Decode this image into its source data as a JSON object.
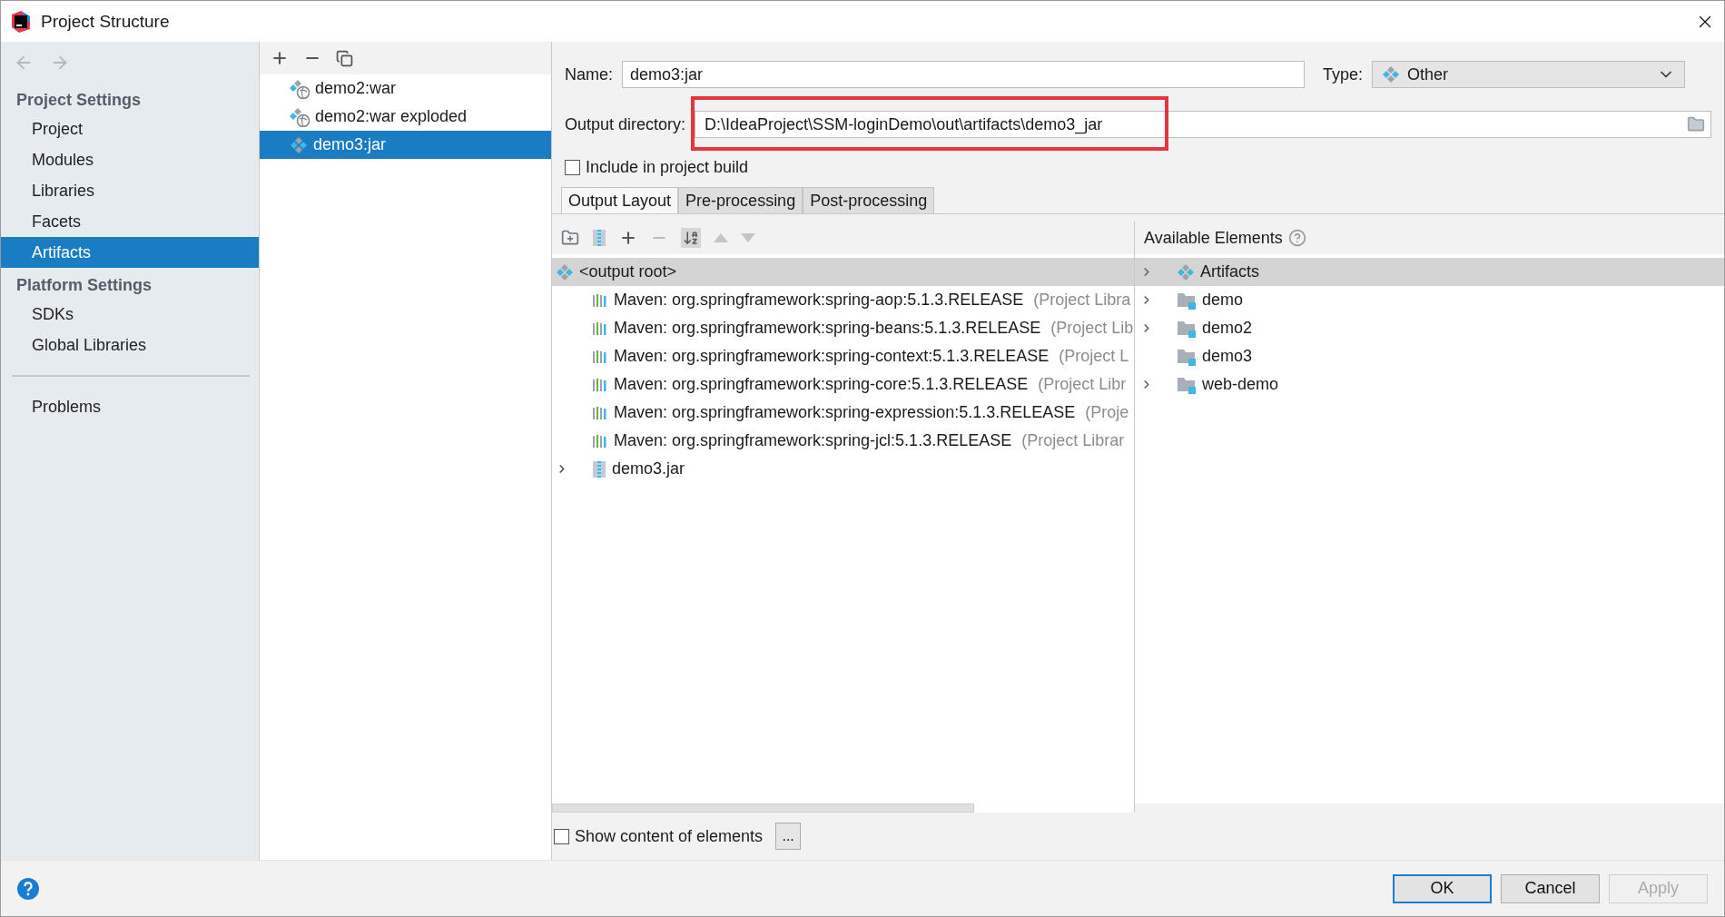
{
  "window": {
    "title": "Project Structure"
  },
  "sidebar": {
    "groups": [
      {
        "heading": "Project Settings",
        "items": [
          {
            "label": "Project",
            "selected": false
          },
          {
            "label": "Modules",
            "selected": false
          },
          {
            "label": "Libraries",
            "selected": false
          },
          {
            "label": "Facets",
            "selected": false
          },
          {
            "label": "Artifacts",
            "selected": true
          }
        ]
      },
      {
        "heading": "Platform Settings",
        "items": [
          {
            "label": "SDKs",
            "selected": false
          },
          {
            "label": "Global Libraries",
            "selected": false
          }
        ]
      }
    ],
    "footer_items": [
      {
        "label": "Problems",
        "selected": false
      }
    ]
  },
  "artifacts_list": [
    {
      "label": "demo2:war",
      "kind": "war",
      "selected": false
    },
    {
      "label": "demo2:war exploded",
      "kind": "war",
      "selected": false
    },
    {
      "label": "demo3:jar",
      "kind": "jar",
      "selected": true
    }
  ],
  "form": {
    "name_label": "Name:",
    "name_value": "demo3:jar",
    "type_label": "Type:",
    "type_value": "Other",
    "output_label": "Output directory:",
    "output_value": "D:\\IdeaProject\\SSM-loginDemo\\out\\artifacts\\demo3_jar",
    "output_highlighted": true,
    "include_label": "Include in project build",
    "include_checked": false
  },
  "tabs": [
    {
      "label": "Output Layout",
      "selected": true
    },
    {
      "label": "Pre-processing",
      "selected": false
    },
    {
      "label": "Post-processing",
      "selected": false
    }
  ],
  "layout_tree": [
    {
      "kind": "root",
      "label": "<output root>",
      "selected": true
    },
    {
      "kind": "library",
      "label": "Maven: org.springframework:spring-aop:5.1.3.RELEASE",
      "suffix": "(Project Libra",
      "selected": false
    },
    {
      "kind": "library",
      "label": "Maven: org.springframework:spring-beans:5.1.3.RELEASE",
      "suffix": "(Project Lib",
      "selected": false
    },
    {
      "kind": "library",
      "label": "Maven: org.springframework:spring-context:5.1.3.RELEASE",
      "suffix": "(Project L",
      "selected": false
    },
    {
      "kind": "library",
      "label": "Maven: org.springframework:spring-core:5.1.3.RELEASE",
      "suffix": "(Project Libr",
      "selected": false
    },
    {
      "kind": "library",
      "label": "Maven: org.springframework:spring-expression:5.1.3.RELEASE",
      "suffix": "(Proje",
      "selected": false
    },
    {
      "kind": "library",
      "label": "Maven: org.springframework:spring-jcl:5.1.3.RELEASE",
      "suffix": "(Project Librar",
      "selected": false
    },
    {
      "kind": "jar",
      "label": "demo3.jar",
      "expandable": true,
      "selected": false
    }
  ],
  "available": {
    "title": "Available Elements",
    "items": [
      {
        "kind": "artifacts",
        "label": "Artifacts",
        "expandable": true,
        "selected": true
      },
      {
        "kind": "module",
        "label": "demo",
        "expandable": true,
        "selected": false
      },
      {
        "kind": "module",
        "label": "demo2",
        "expandable": true,
        "selected": false
      },
      {
        "kind": "module",
        "label": "demo3",
        "expandable": false,
        "selected": false
      },
      {
        "kind": "module",
        "label": "web-demo",
        "expandable": true,
        "selected": false
      }
    ]
  },
  "show_content": {
    "label": "Show content of elements",
    "checked": false
  },
  "more_button": "...",
  "buttons": [
    {
      "label": "OK",
      "kind": "primary",
      "disabled": false
    },
    {
      "label": "Cancel",
      "kind": "normal",
      "disabled": false
    },
    {
      "label": "Apply",
      "kind": "normal",
      "disabled": true
    }
  ]
}
